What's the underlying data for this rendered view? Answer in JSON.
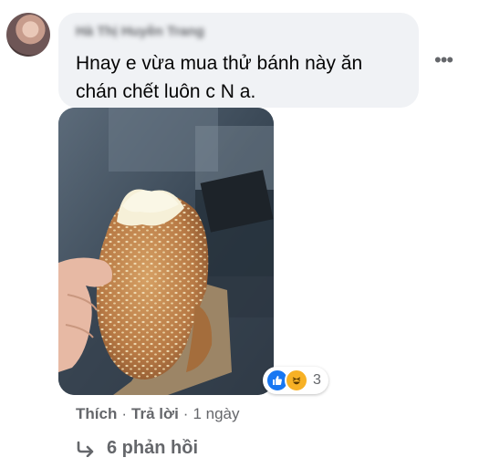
{
  "comment": {
    "author_name": "Hà Thị Huyền Trang",
    "text": "Hnay e vừa mua thử bánh này ăn\nchán chết luôn c N a.",
    "more_options": "•••"
  },
  "reactions": {
    "icons": [
      "like-icon",
      "haha-icon"
    ],
    "count": "3"
  },
  "actions": {
    "like": "Thích",
    "reply": "Trả lời",
    "separator": "·",
    "time": "1 ngày"
  },
  "replies": {
    "label": "6 phản hồi"
  },
  "colors": {
    "bubble": "#f0f2f5",
    "secondary_text": "#65676b",
    "primary_text": "#050505",
    "like_blue": "#1877f2",
    "haha_yellow": "#f7b125"
  }
}
